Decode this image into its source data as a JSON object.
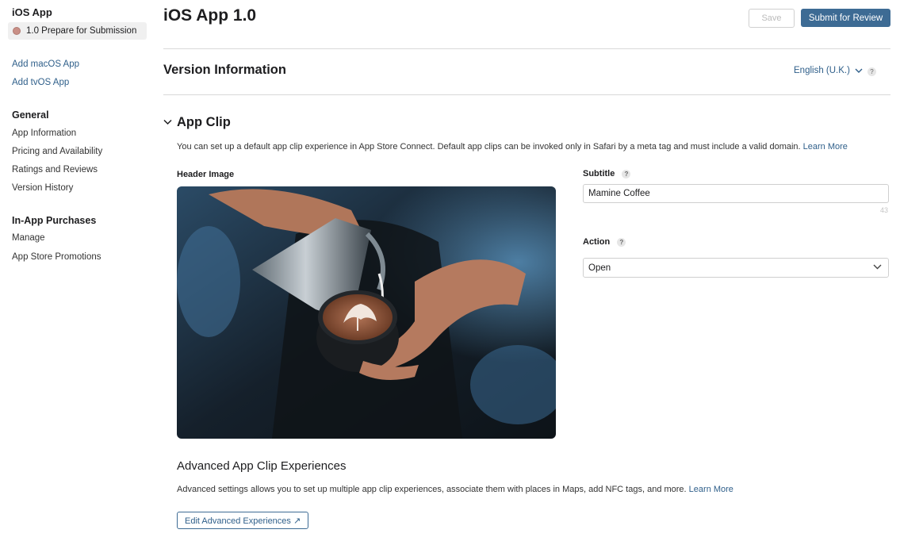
{
  "sidebar": {
    "app_title": "iOS App",
    "status_label": "1.0 Prepare for Submission",
    "platform_links": [
      "Add macOS App",
      "Add tvOS App"
    ],
    "general_heading": "General",
    "general_items": [
      "App Information",
      "Pricing and Availability",
      "Ratings and Reviews",
      "Version History"
    ],
    "iap_heading": "In-App Purchases",
    "iap_items": [
      "Manage",
      "App Store Promotions"
    ]
  },
  "header": {
    "title": "iOS App 1.0",
    "save_label": "Save",
    "submit_label": "Submit for Review"
  },
  "version_info": {
    "title": "Version Information",
    "language": "English (U.K.)",
    "help": "?"
  },
  "app_clip": {
    "title": "App Clip",
    "description": "You can set up a default app clip experience in App Store Connect. Default app clips can be invoked only in Safari by a meta tag and must include a valid domain.",
    "learn_more": "Learn More",
    "header_image_label": "Header Image",
    "subtitle_label": "Subtitle",
    "subtitle_value": "Mamine Coffee",
    "subtitle_char_count": "43",
    "action_label": "Action",
    "action_value": "Open",
    "help": "?"
  },
  "advanced": {
    "title": "Advanced App Clip Experiences",
    "description": "Advanced settings allows you to set up multiple app clip experiences, associate them with places in Maps, add NFC tags, and more.",
    "learn_more": "Learn More",
    "button_label": "Edit Advanced Experiences ↗"
  },
  "colors": {
    "accent": "#3d6b94",
    "link": "#2f5f8a",
    "status_dot": "#c98f86"
  }
}
